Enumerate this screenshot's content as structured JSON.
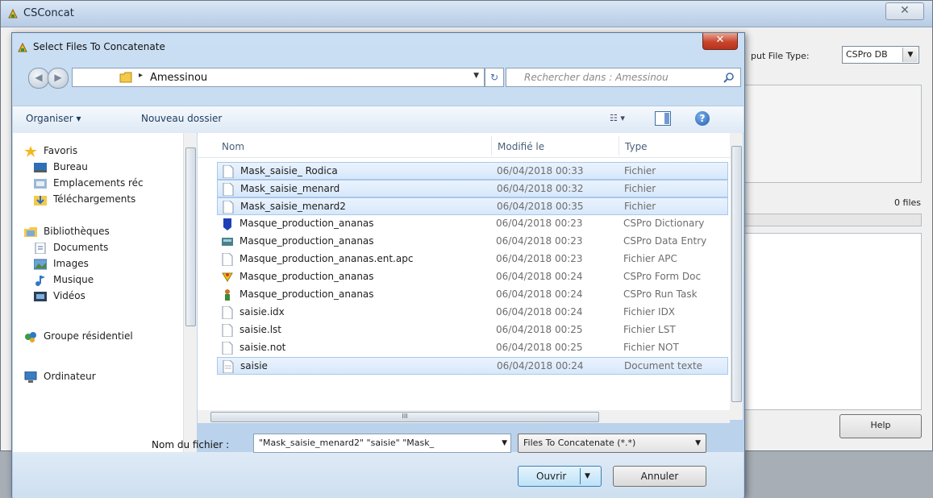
{
  "main_window": {
    "title": "CSConcat",
    "close_glyph": "✕",
    "output_type_label": "put File Type:",
    "output_type_value": "CSPro DB",
    "files_count": "0 files",
    "help_label": "Help"
  },
  "dialog": {
    "title": "Select Files To Concatenate",
    "close_glyph": "✕",
    "address": {
      "separator": "▸",
      "folder": "Amessinou",
      "dropdown": "▼"
    },
    "refresh_glyph": "↻",
    "search_placeholder": "Rechercher dans : Amessinou",
    "toolbar": {
      "organize": "Organiser ▾",
      "new_folder": "Nouveau dossier",
      "views": "☷ ▾"
    },
    "nav": {
      "favorites": "Favoris",
      "desktop": "Bureau",
      "recent": "Emplacements réc",
      "downloads": "Téléchargements",
      "libraries": "Bibliothèques",
      "documents": "Documents",
      "images": "Images",
      "music": "Musique",
      "videos": "Vidéos",
      "homegroup": "Groupe résidentiel",
      "computer": "Ordinateur"
    },
    "columns": {
      "name": "Nom",
      "modified": "Modifié le",
      "type": "Type"
    },
    "files": [
      {
        "name": "Mask_saisie_ Rodica",
        "date": "06/04/2018 00:33",
        "type": "Fichier"
      },
      {
        "name": "Mask_saisie_menard",
        "date": "06/04/2018 00:32",
        "type": "Fichier"
      },
      {
        "name": "Mask_saisie_menard2",
        "date": "06/04/2018 00:35",
        "type": "Fichier"
      },
      {
        "name": "Masque_production_ananas",
        "date": "06/04/2018 00:23",
        "type": "CSPro Dictionary"
      },
      {
        "name": "Masque_production_ananas",
        "date": "06/04/2018 00:23",
        "type": "CSPro Data Entry"
      },
      {
        "name": "Masque_production_ananas.ent.apc",
        "date": "06/04/2018 00:23",
        "type": "Fichier APC"
      },
      {
        "name": "Masque_production_ananas",
        "date": "06/04/2018 00:24",
        "type": "CSPro Form Doc"
      },
      {
        "name": "Masque_production_ananas",
        "date": "06/04/2018 00:24",
        "type": "CSPro Run Task"
      },
      {
        "name": "saisie.idx",
        "date": "06/04/2018 00:24",
        "type": "Fichier IDX"
      },
      {
        "name": "saisie.lst",
        "date": "06/04/2018 00:25",
        "type": "Fichier LST"
      },
      {
        "name": "saisie.not",
        "date": "06/04/2018 00:25",
        "type": "Fichier NOT"
      },
      {
        "name": "saisie",
        "date": "06/04/2018 00:24",
        "type": "Document texte"
      }
    ],
    "hscroll_grip": "III",
    "filename_label": "Nom du fichier :",
    "filename_value": "\"Mask_saisie_menard2\" \"saisie\" \"Mask_",
    "filetype_value": "Files To Concatenate (*.*)",
    "open_label": "Ouvrir",
    "cancel_label": "Annuler"
  },
  "colors": {
    "selection_bg": "#d7e8fb",
    "selection_border": "#a8c8ec",
    "dialog_frame": "#b8d0ea",
    "close_red": "#c9452d"
  }
}
